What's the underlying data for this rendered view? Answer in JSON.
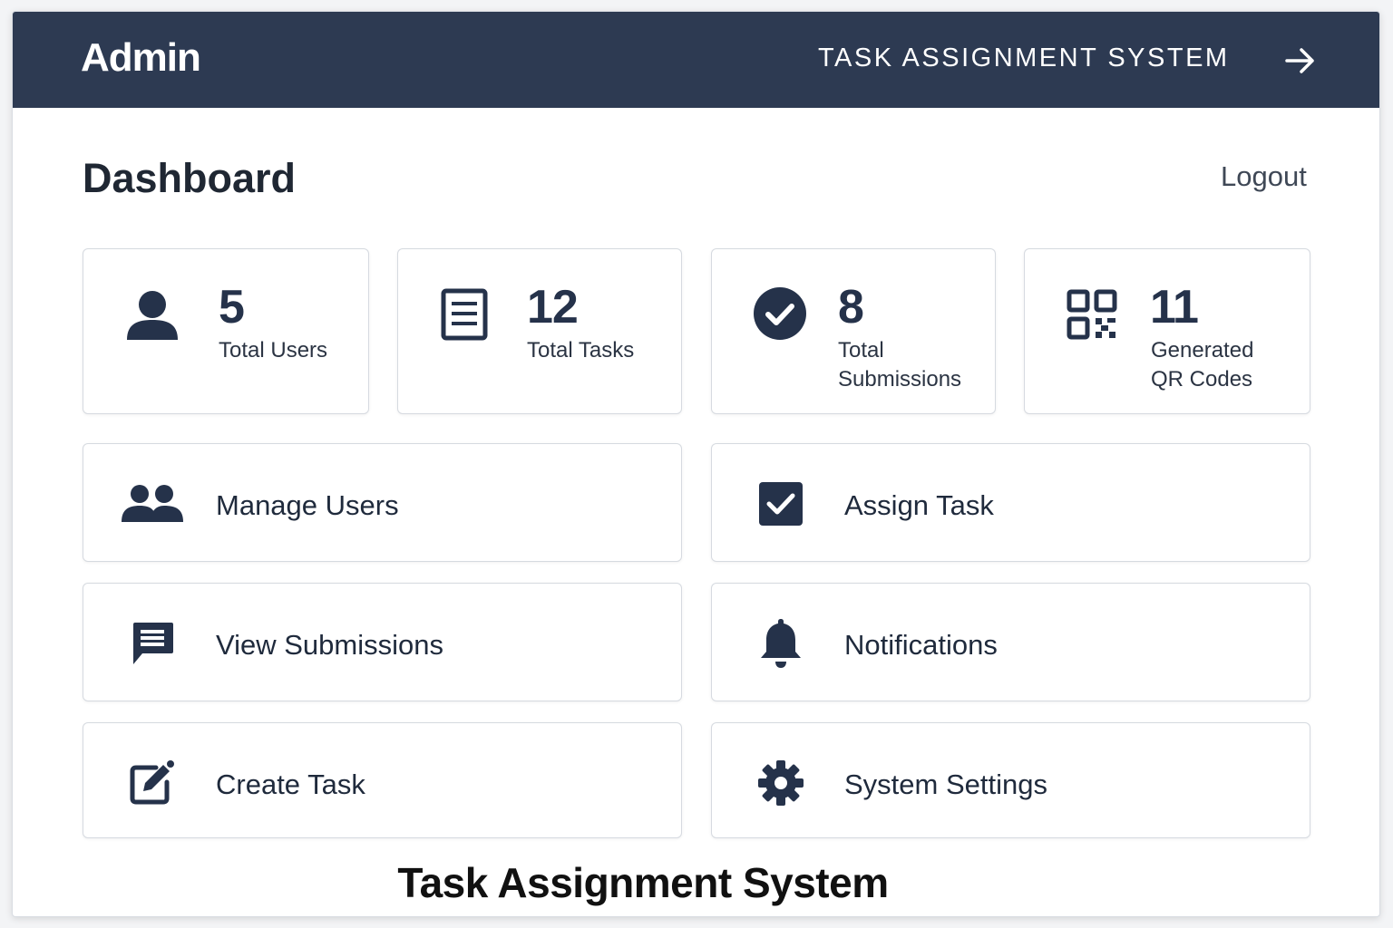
{
  "header": {
    "brand": "Admin",
    "system_name": "TASK ASSIGNMENT SYSTEM",
    "exit_icon": "arrow-right-icon",
    "background": "#2d3a52"
  },
  "page": {
    "title": "Dashboard",
    "logout_label": "Logout"
  },
  "stats": [
    {
      "icon": "user-icon",
      "value": "5",
      "label": "Total Users"
    },
    {
      "icon": "document-icon",
      "value": "12",
      "label": "Total Tasks"
    },
    {
      "icon": "check-circle-icon",
      "value": "8",
      "label_line1": "Total",
      "label_line2": "Submissions"
    },
    {
      "icon": "qr-code-icon",
      "value": "11",
      "label_line1": "Generated",
      "label_line2": "QR Codes"
    }
  ],
  "actions": [
    {
      "icon": "users-icon",
      "label": "Manage Users"
    },
    {
      "icon": "checkbox-icon",
      "label": "Assign Task"
    },
    {
      "icon": "message-icon",
      "label": "View Submissions"
    },
    {
      "icon": "bell-icon",
      "label": "Notifications"
    },
    {
      "icon": "edit-icon",
      "label": "Create Task"
    },
    {
      "icon": "gear-icon",
      "label": "System Settings"
    }
  ],
  "caption": "Task Assignment System",
  "colors": {
    "accent": "#2d3a52",
    "icon": "#25324a"
  }
}
